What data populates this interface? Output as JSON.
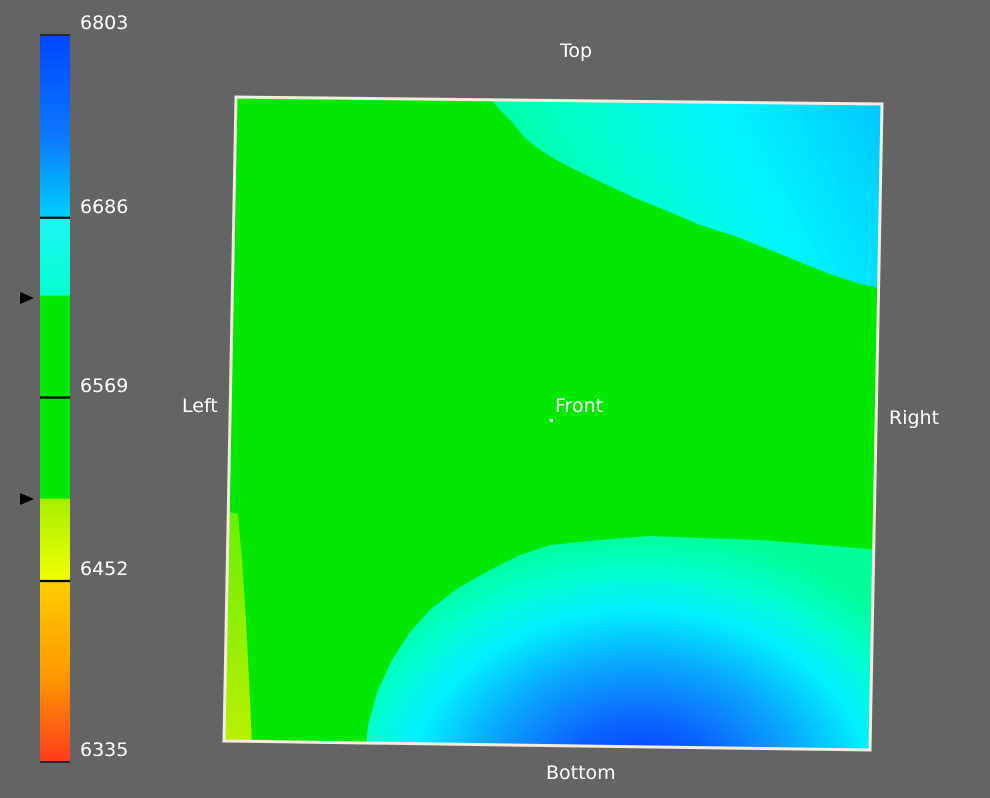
{
  "colorbar": {
    "ticks": [
      "6803",
      "6686",
      "6569",
      "6452",
      "6335"
    ],
    "markers": [
      "level-marker-upper",
      "level-marker-lower"
    ],
    "colors": {
      "max": "#0048ff",
      "high": "#00cfff",
      "mid_high": "#1ff5f5",
      "mid": "#00e800",
      "mid_low": "#f0ff00",
      "low": "#ffcc00",
      "min": "#ff3a1a"
    }
  },
  "view": {
    "top": "Top",
    "bottom": "Bottom",
    "left": "Left",
    "right": "Right",
    "front": "Front"
  },
  "colors": {
    "background": "#646464",
    "frame": "#f5ece0",
    "fill": "#00e800"
  }
}
